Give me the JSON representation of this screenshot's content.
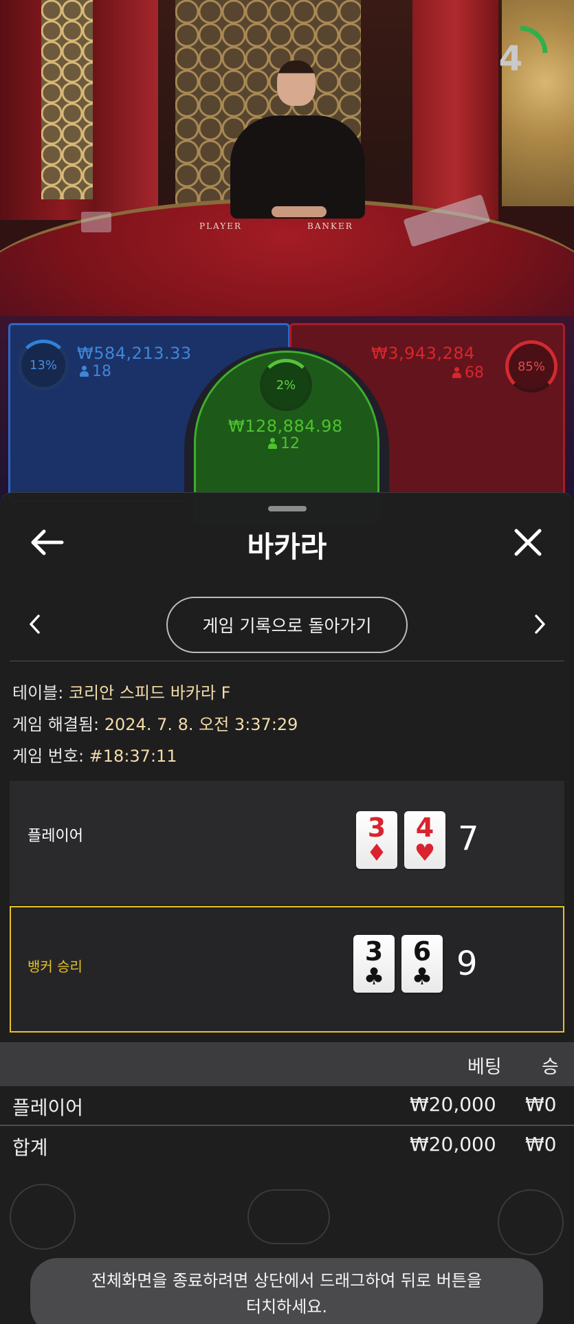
{
  "video": {
    "table_player_text": "PLAYER",
    "table_banker_text": "BANKER",
    "timer_value": "4",
    "timer_fraction": 0.25
  },
  "bets": {
    "player": {
      "percent": "13%",
      "amount": "₩584,213.33",
      "players": "18",
      "percent_value": 0.13
    },
    "tie": {
      "percent": "2%",
      "amount": "₩128,884.98",
      "players": "12",
      "percent_value": 0.02
    },
    "banker": {
      "percent": "85%",
      "amount": "₩3,943,284",
      "players": "68",
      "percent_value": 0.85
    }
  },
  "sheet": {
    "title": "바카라",
    "back_to_history": "게임 기록으로 돌아가기",
    "info": {
      "table_label": "테이블: ",
      "table_value": "코리안 스피드 바카라 F",
      "resolved_label": "게임 해결됨: ",
      "resolved_value": "2024. 7. 8. 오전 3:37:29",
      "round_label": "게임 번호: ",
      "round_value": "#18:37:11"
    },
    "hands": {
      "player": {
        "label": "플레이어",
        "cards": [
          {
            "rank": "3",
            "suit": "♦"
          },
          {
            "rank": "4",
            "suit": "♥"
          }
        ],
        "score": "7"
      },
      "banker": {
        "label": "뱅커 승리",
        "cards": [
          {
            "rank": "3",
            "suit": "♣"
          },
          {
            "rank": "6",
            "suit": "♣"
          }
        ],
        "score": "9"
      }
    },
    "bets_table": {
      "headers": [
        "베팅",
        "승"
      ],
      "rows": [
        {
          "name": "플레이어",
          "bet": "₩20,000",
          "win": "₩0"
        }
      ],
      "total": {
        "name": "합계",
        "bet": "₩20,000",
        "win": "₩0"
      }
    }
  },
  "toast": {
    "line1": "전체화면을 종료하려면 상단에서 드래그하여 뒤로 버튼을",
    "line2": "터치하세요."
  },
  "colors": {
    "player": "#2f82d8",
    "banker": "#d12a30",
    "tie": "#3fae2c",
    "highlight": "#e6c22a",
    "value_text": "#f3dca7"
  }
}
